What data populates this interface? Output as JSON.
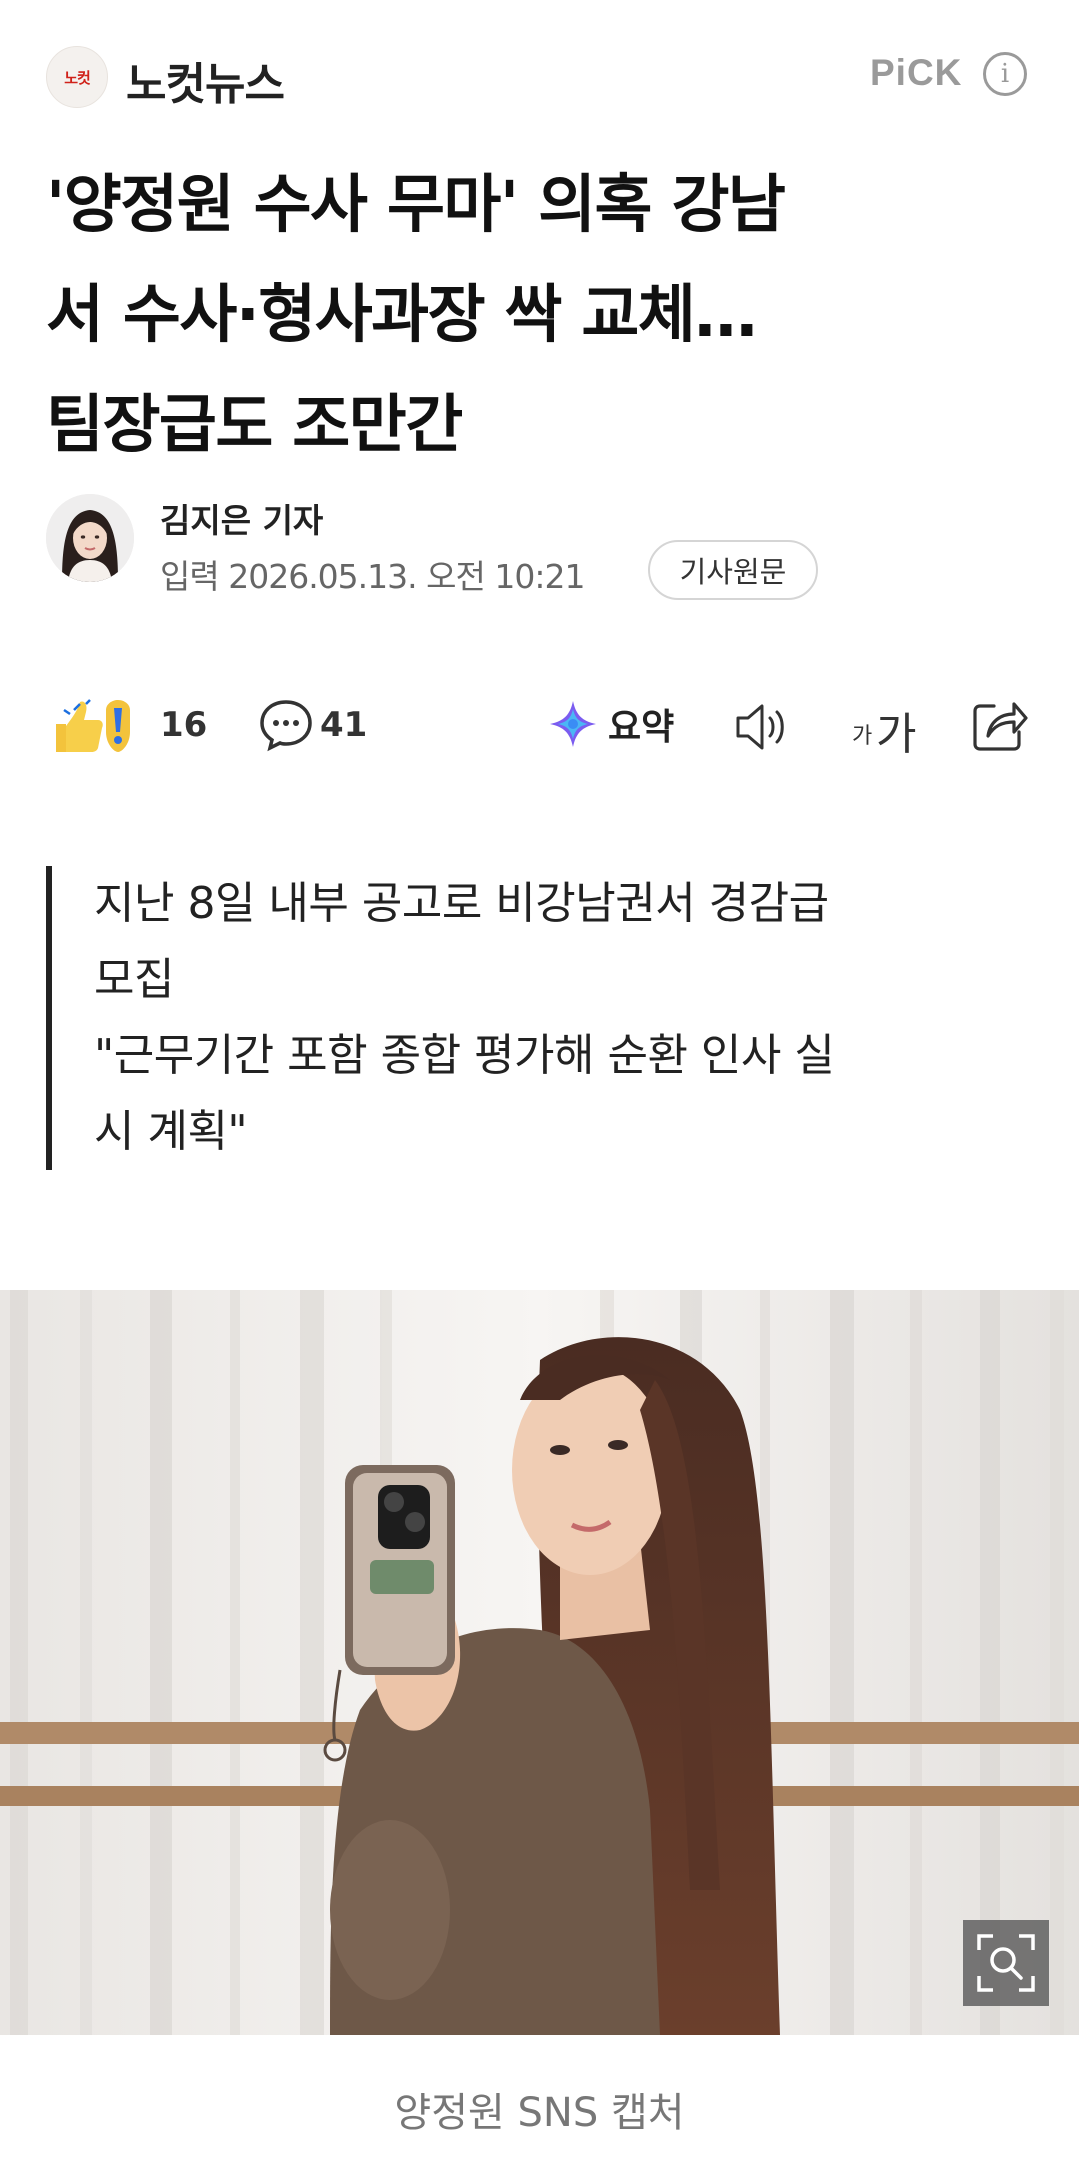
{
  "header": {
    "press_logo_text": "노컷",
    "press_name": "노컷뉴스",
    "pick_label": "PiCK",
    "info_glyph": "i"
  },
  "article": {
    "title_lines": [
      "'양정원 수사 무마' 의혹 강남",
      "서 수사·형사과장 싹 교체…",
      "팀장급도 조만간"
    ],
    "reporter": "김지은 기자",
    "published": "입력 2026.05.13. 오전 10:21",
    "original_button": "기사원문",
    "summary_lines": [
      "지난 8일 내부 공고로 비강남권서 경감급",
      "모집",
      "\"근무기간 포함 종합 평가해 순환 인사 실",
      "시 계획\""
    ],
    "photo_caption": "양정원 SNS 캡처"
  },
  "actions": {
    "reaction_count": "16",
    "comment_count": "41",
    "summary_label": "요약",
    "font_small": "가",
    "font_large": "가"
  },
  "icons": {
    "reaction": "thumbs-up-and-exclamation-icon",
    "comment": "speech-bubble-icon",
    "summary": "sparkle-icon",
    "audio": "speaker-icon",
    "font": "font-size-icon",
    "share": "share-icon",
    "zoom": "zoom-icon",
    "info": "info-icon"
  },
  "colors": {
    "brand_red": "#d0221a",
    "pick_gray": "#9a9a9a",
    "text": "#111111",
    "meta": "#666666",
    "quote_bar": "#222222"
  }
}
